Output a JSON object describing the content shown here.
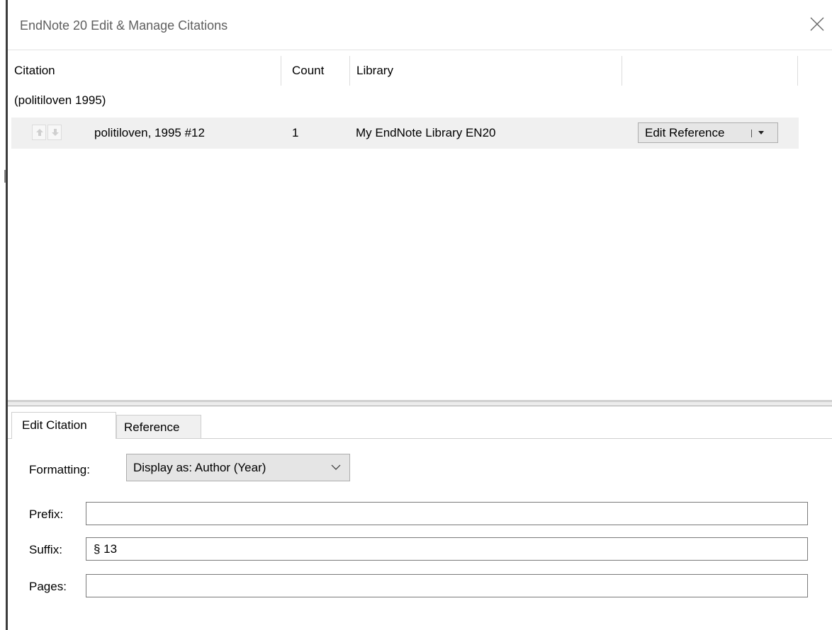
{
  "window": {
    "title": "EndNote 20 Edit & Manage Citations",
    "close_icon": "close-icon"
  },
  "citation_list": {
    "columns": [
      "Citation",
      "Count",
      "Library",
      ""
    ],
    "groups": [
      {
        "label": "(politiloven 1995)",
        "rows": [
          {
            "citation": "politiloven, 1995 #12",
            "count": "1",
            "library": "My EndNote Library EN20",
            "action_label": "Edit Reference",
            "move_up_icon": "arrow-up-icon",
            "move_down_icon": "arrow-down-icon",
            "action_menu_icon": "caret-down-icon"
          }
        ]
      }
    ]
  },
  "tabs": [
    {
      "label": "Edit Citation",
      "selected": true
    },
    {
      "label": "Reference",
      "selected": false
    }
  ],
  "edit_citation": {
    "formatting": {
      "label": "Formatting:",
      "value": "Display as: Author (Year)",
      "chevron_icon": "chevron-down-icon"
    },
    "prefix": {
      "label": "Prefix:",
      "value": ""
    },
    "suffix": {
      "label": "Suffix:",
      "value": "§ 13"
    },
    "pages": {
      "label": "Pages:",
      "value": ""
    }
  }
}
